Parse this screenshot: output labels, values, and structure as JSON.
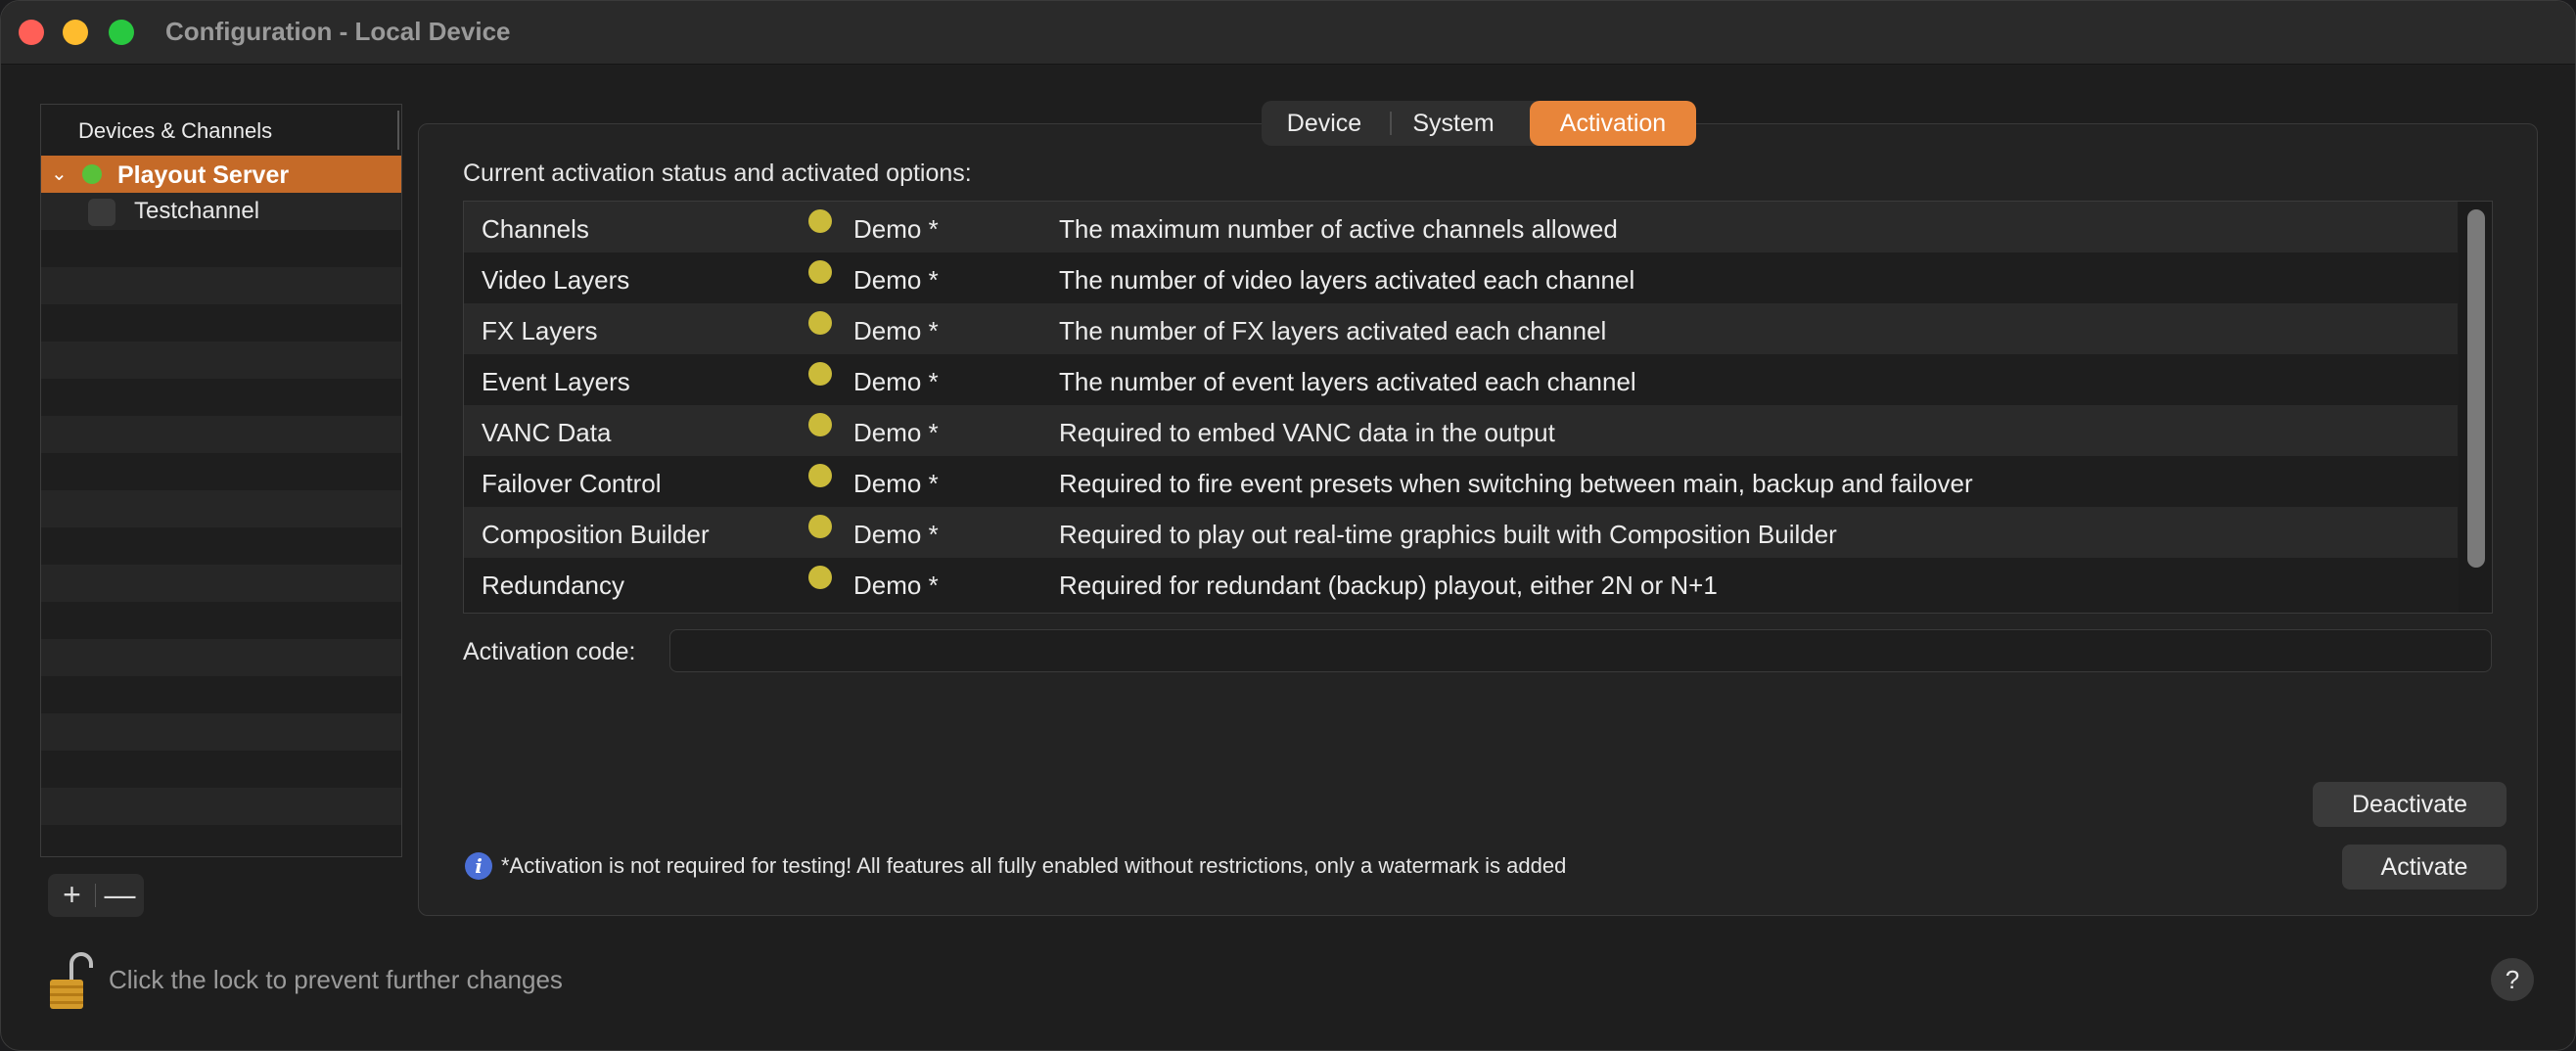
{
  "window": {
    "title": "Configuration - Local Device"
  },
  "sidebar": {
    "header": "Devices & Channels",
    "items": [
      {
        "label": "Playout Server",
        "status_color": "#58c13a",
        "selected": true,
        "expanded": true
      },
      {
        "label": "Testchannel",
        "selected": false
      }
    ],
    "add_label": "+",
    "remove_label": "—"
  },
  "tabs": [
    {
      "label": "Device",
      "active": false
    },
    {
      "label": "System",
      "active": false
    },
    {
      "label": "Activation",
      "active": true
    }
  ],
  "activation": {
    "status_label": "Current activation status and activated options:",
    "rows": [
      {
        "name": "Channels",
        "status": "Demo *",
        "description": "The maximum number of active channels allowed"
      },
      {
        "name": "Video Layers",
        "status": "Demo *",
        "description": "The number of video layers activated each channel"
      },
      {
        "name": "FX Layers",
        "status": "Demo *",
        "description": "The number of FX layers activated each channel"
      },
      {
        "name": "Event Layers",
        "status": "Demo *",
        "description": "The number of event layers activated each channel"
      },
      {
        "name": "VANC Data",
        "status": "Demo *",
        "description": "Required to embed VANC data in the output"
      },
      {
        "name": "Failover Control",
        "status": "Demo *",
        "description": "Required to fire event presets when switching between main, backup and failover"
      },
      {
        "name": "Composition Builder",
        "status": "Demo *",
        "description": "Required to play out real-time graphics built with Composition Builder"
      },
      {
        "name": "Redundancy",
        "status": "Demo *",
        "description": "Required for redundant (backup) playout, either 2N or N+1"
      }
    ],
    "status_color": "#cbbb3a",
    "code_label": "Activation code:",
    "code_value": "",
    "deactivate_label": "Deactivate",
    "activate_label": "Activate",
    "info_text": "*Activation is not required for testing! All features all fully enabled without restrictions, only a watermark is added"
  },
  "footer": {
    "lock_text": "Click the lock to prevent further changes",
    "help_label": "?"
  },
  "colors": {
    "accent": "#e8853a",
    "selection": "#c56a28",
    "online": "#58c13a",
    "demo": "#cbbb3a",
    "info": "#4b6fd6"
  }
}
